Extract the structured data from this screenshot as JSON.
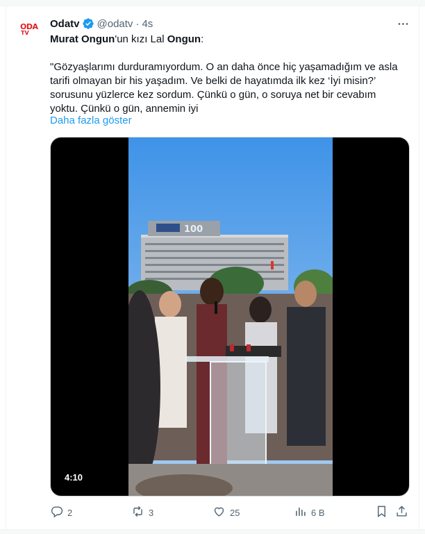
{
  "tweet": {
    "display_name": "Odatv",
    "handle": "@odatv",
    "separator": "·",
    "time": "4s",
    "avatar_text_top": "ODA",
    "avatar_text_bottom": "TV",
    "text": {
      "line1_name_a": "Murat Ongun",
      "line1_mid": "'un kızı Lal ",
      "line1_name_b": "Ongun",
      "line1_end": ":",
      "p1": "\"Gözyaşlarımı durduramıyordum. O an daha önce hiç yaşamadığım ve asla",
      "p2": "tarifi olmayan bir his yaşadım. Ve belki de hayatımda ilk kez ‘İyi misin?’",
      "p3": "sorusunu yüzlerce kez sordum. Çünkü o gün, o soruya net bir cevabım",
      "p4": "yoktu. Çünkü o gün, annemin iyi"
    },
    "show_more": "Daha fazla göster",
    "video": {
      "duration": "4:10",
      "building_sign": "100"
    },
    "actions": {
      "replies": "2",
      "reposts": "3",
      "likes": "25",
      "views": "6 B"
    }
  },
  "colors": {
    "accent": "#1d9bf0",
    "secondary_text": "#536471",
    "brand_red": "#e01e24"
  }
}
